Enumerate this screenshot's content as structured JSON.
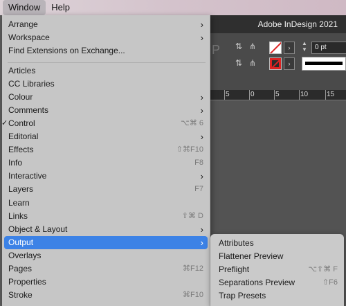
{
  "menubar": {
    "window": "Window",
    "help": "Help"
  },
  "app": {
    "title": "Adobe InDesign 2021",
    "stroke_weight": "0 pt",
    "ruler_labels": [
      "5",
      "0",
      "5",
      "10",
      "15"
    ]
  },
  "menu": {
    "items": [
      {
        "label": "Arrange",
        "submenu": true
      },
      {
        "label": "Workspace",
        "submenu": true
      },
      {
        "label": "Find Extensions on Exchange..."
      },
      {
        "label": "Articles"
      },
      {
        "label": "CC Libraries"
      },
      {
        "label": "Colour",
        "submenu": true
      },
      {
        "label": "Comments",
        "submenu": true
      },
      {
        "label": "Control",
        "checked": true,
        "shortcut": "⌥⌘ 6"
      },
      {
        "label": "Editorial",
        "submenu": true
      },
      {
        "label": "Effects",
        "shortcut": "⇧⌘F10"
      },
      {
        "label": "Info",
        "shortcut": "F8"
      },
      {
        "label": "Interactive",
        "submenu": true
      },
      {
        "label": "Layers",
        "shortcut": "F7"
      },
      {
        "label": "Learn"
      },
      {
        "label": "Links",
        "shortcut": "⇧⌘ D"
      },
      {
        "label": "Object & Layout",
        "submenu": true
      },
      {
        "label": "Output",
        "submenu": true
      },
      {
        "label": "Overlays"
      },
      {
        "label": "Pages",
        "shortcut": "⌘F12"
      },
      {
        "label": "Properties"
      },
      {
        "label": "Stroke",
        "shortcut": "⌘F10"
      }
    ],
    "checkmark": "✓",
    "arrow": "›"
  },
  "submenu": {
    "items": [
      {
        "label": "Attributes"
      },
      {
        "label": "Flattener Preview"
      },
      {
        "label": "Preflight",
        "shortcut": "⌥⇧⌘ F"
      },
      {
        "label": "Separations Preview",
        "shortcut": "⇧F6"
      },
      {
        "label": "Trap Presets"
      }
    ]
  },
  "colors": {
    "highlight": "#3c82e6",
    "menu_bg": "#c6c6c6"
  }
}
